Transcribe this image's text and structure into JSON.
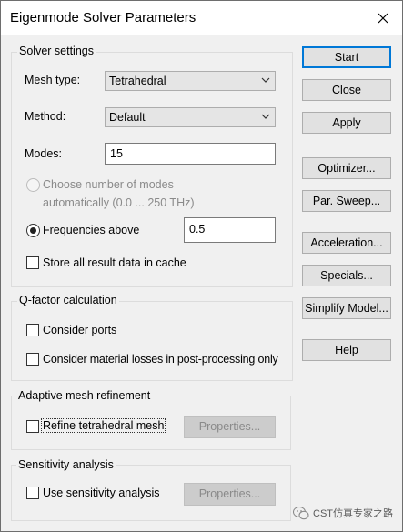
{
  "window": {
    "title": "Eigenmode Solver Parameters"
  },
  "solver_settings": {
    "group_label": "Solver settings",
    "mesh_type_label": "Mesh type:",
    "mesh_type_value": "Tetrahedral",
    "method_label": "Method:",
    "method_value": "Default",
    "modes_label": "Modes:",
    "modes_value": "15",
    "choose_modes_line1": "Choose number of modes",
    "choose_modes_line2": "automatically (0.0 ... 250 THz)",
    "freq_above_label": "Frequencies above",
    "freq_above_value": "0.5",
    "store_cache_label": "Store all result data in cache"
  },
  "qfactor": {
    "group_label": "Q-factor calculation",
    "consider_ports_label": "Consider ports",
    "consider_losses_label": "Consider material losses in post-processing only"
  },
  "adaptive": {
    "group_label": "Adaptive mesh refinement",
    "refine_label": "Refine tetrahedral mesh",
    "properties_label": "Properties..."
  },
  "sensitivity": {
    "group_label": "Sensitivity analysis",
    "use_label": "Use sensitivity analysis",
    "properties_label": "Properties..."
  },
  "buttons": {
    "start": "Start",
    "close": "Close",
    "apply": "Apply",
    "optimizer": "Optimizer...",
    "par_sweep": "Par. Sweep...",
    "acceleration": "Acceleration...",
    "specials": "Specials...",
    "simplify_model": "Simplify Model...",
    "help": "Help"
  },
  "watermark": {
    "text": "CST仿真专家之路"
  }
}
